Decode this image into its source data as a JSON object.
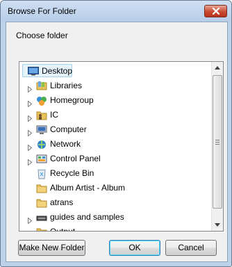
{
  "window": {
    "title": "Browse For Folder"
  },
  "dialog": {
    "description": "Choose folder"
  },
  "tree": {
    "items": [
      {
        "label": "Desktop",
        "icon": "desktop-icon",
        "expandable": false,
        "selected": true,
        "level": 0
      },
      {
        "label": "Libraries",
        "icon": "libraries-icon",
        "expandable": true,
        "level": 1
      },
      {
        "label": "Homegroup",
        "icon": "homegroup-icon",
        "expandable": true,
        "level": 1
      },
      {
        "label": "IC",
        "icon": "user-folder-icon",
        "expandable": true,
        "level": 1
      },
      {
        "label": "Computer",
        "icon": "computer-icon",
        "expandable": true,
        "level": 1
      },
      {
        "label": "Network",
        "icon": "network-icon",
        "expandable": true,
        "level": 1
      },
      {
        "label": "Control Panel",
        "icon": "control-panel-icon",
        "expandable": true,
        "level": 1
      },
      {
        "label": "Recycle Bin",
        "icon": "recycle-bin-icon",
        "expandable": false,
        "level": 1
      },
      {
        "label": "Album Artist - Album",
        "icon": "folder-icon",
        "expandable": false,
        "level": 1
      },
      {
        "label": "atrans",
        "icon": "folder-icon",
        "expandable": false,
        "level": 1
      },
      {
        "label": "guides and samples",
        "icon": "drive-icon",
        "expandable": true,
        "level": 1
      },
      {
        "label": "Output",
        "icon": "folder-icon",
        "expandable": false,
        "level": 1
      }
    ]
  },
  "buttons": {
    "make_new_folder": "Make New Folder",
    "ok": "OK",
    "cancel": "Cancel"
  },
  "colors": {
    "frame": "#bcd1ea",
    "close_button": "#c94a32",
    "selection": "#e5f3fb",
    "folder": "#e8c25a"
  }
}
